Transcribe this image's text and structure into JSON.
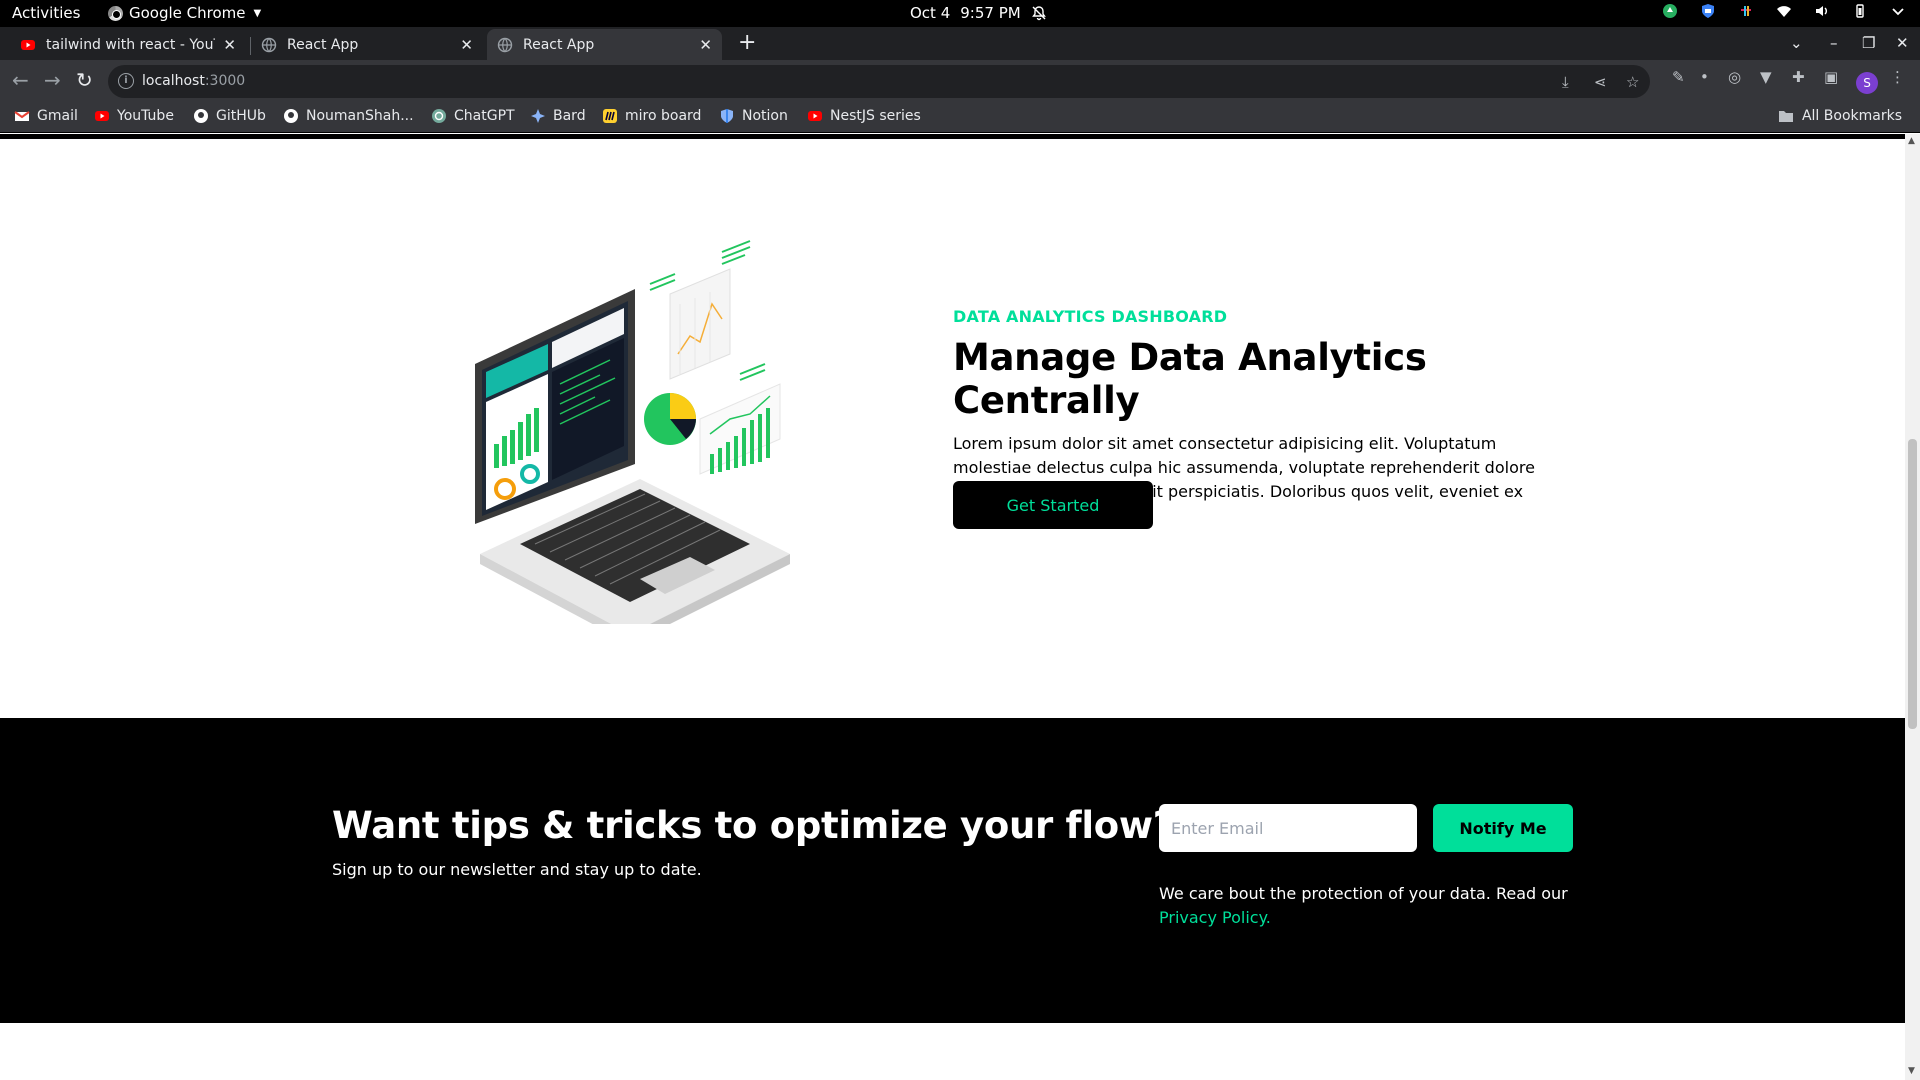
{
  "system": {
    "activities": "Activities",
    "app_name": "Google Chrome",
    "date": "Oct 4",
    "time": "9:57 PM"
  },
  "browser": {
    "tabs": [
      {
        "title": "tailwind with react - YouTube",
        "icon": "youtube-icon",
        "active": false
      },
      {
        "title": "React App",
        "icon": "globe-icon",
        "active": false
      },
      {
        "title": "React App",
        "icon": "globe-icon",
        "active": true
      }
    ],
    "url_host": "localhost",
    "url_port": ":3000",
    "profile_initial": "S",
    "bookmarks": [
      {
        "label": "Gmail",
        "icon": "gmail-icon"
      },
      {
        "label": "YouTube",
        "icon": "youtube-icon"
      },
      {
        "label": "GitHUb",
        "icon": "github-icon"
      },
      {
        "label": "NoumanShah...",
        "icon": "github-icon"
      },
      {
        "label": "ChatGPT",
        "icon": "chatgpt-icon"
      },
      {
        "label": "Bard",
        "icon": "bard-icon"
      },
      {
        "label": "miro board",
        "icon": "miro-icon"
      },
      {
        "label": "Notion",
        "icon": "notion-icon"
      },
      {
        "label": "NestJS series",
        "icon": "youtube-icon"
      }
    ],
    "all_bookmarks": "All Bookmarks"
  },
  "hero": {
    "eyebrow": "DATA ANALYTICS DASHBOARD",
    "title": "Manage Data Analytics Centrally",
    "body": "Lorem ipsum dolor sit amet consectetur adipisicing elit. Voluptatum molestiae delectus culpa hic assumenda, voluptate reprehenderit dolore autem cum ullam sed odit perspiciatis. Doloribus quos velit, eveniet ex deserunt fuga?",
    "cta_label": "Get Started"
  },
  "newsletter": {
    "title": "Want tips & tricks to optimize your flow?",
    "subtitle": "Sign up to our newsletter and stay up to date.",
    "email_placeholder": "Enter Email",
    "button_label": "Notify Me",
    "privacy_text": "We care bout the protection of your data. Read our",
    "privacy_link": "Privacy Policy."
  },
  "colors": {
    "accent": "#00df9a",
    "dark": "#000000",
    "chrome_frame": "#202124",
    "chrome_toolbar": "#35363a"
  }
}
